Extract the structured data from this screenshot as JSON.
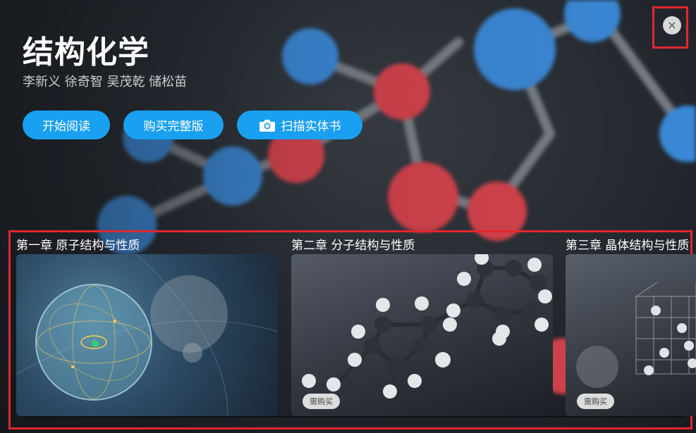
{
  "book": {
    "title": "结构化学",
    "authors": "李新义 徐奇智 吴茂乾 储松苗"
  },
  "actions": {
    "read_label": "开始阅读",
    "buy_label": "购买完整版",
    "scan_label": "扫描实体书"
  },
  "close": {
    "glyph": "×"
  },
  "chapters": [
    {
      "title": "第一章 原子结构与性质",
      "badge": ""
    },
    {
      "title": "第二章 分子结构与性质",
      "badge": "需购买"
    },
    {
      "title": "第三章 晶体结构与性质",
      "badge": "需购买"
    }
  ],
  "colors": {
    "accent": "#1aa0f0",
    "highlight_frame": "#e0282e",
    "atom_blue": "#3d8ee0",
    "atom_red": "#e0454f"
  },
  "icons": [
    "close-icon",
    "camera-icon"
  ]
}
